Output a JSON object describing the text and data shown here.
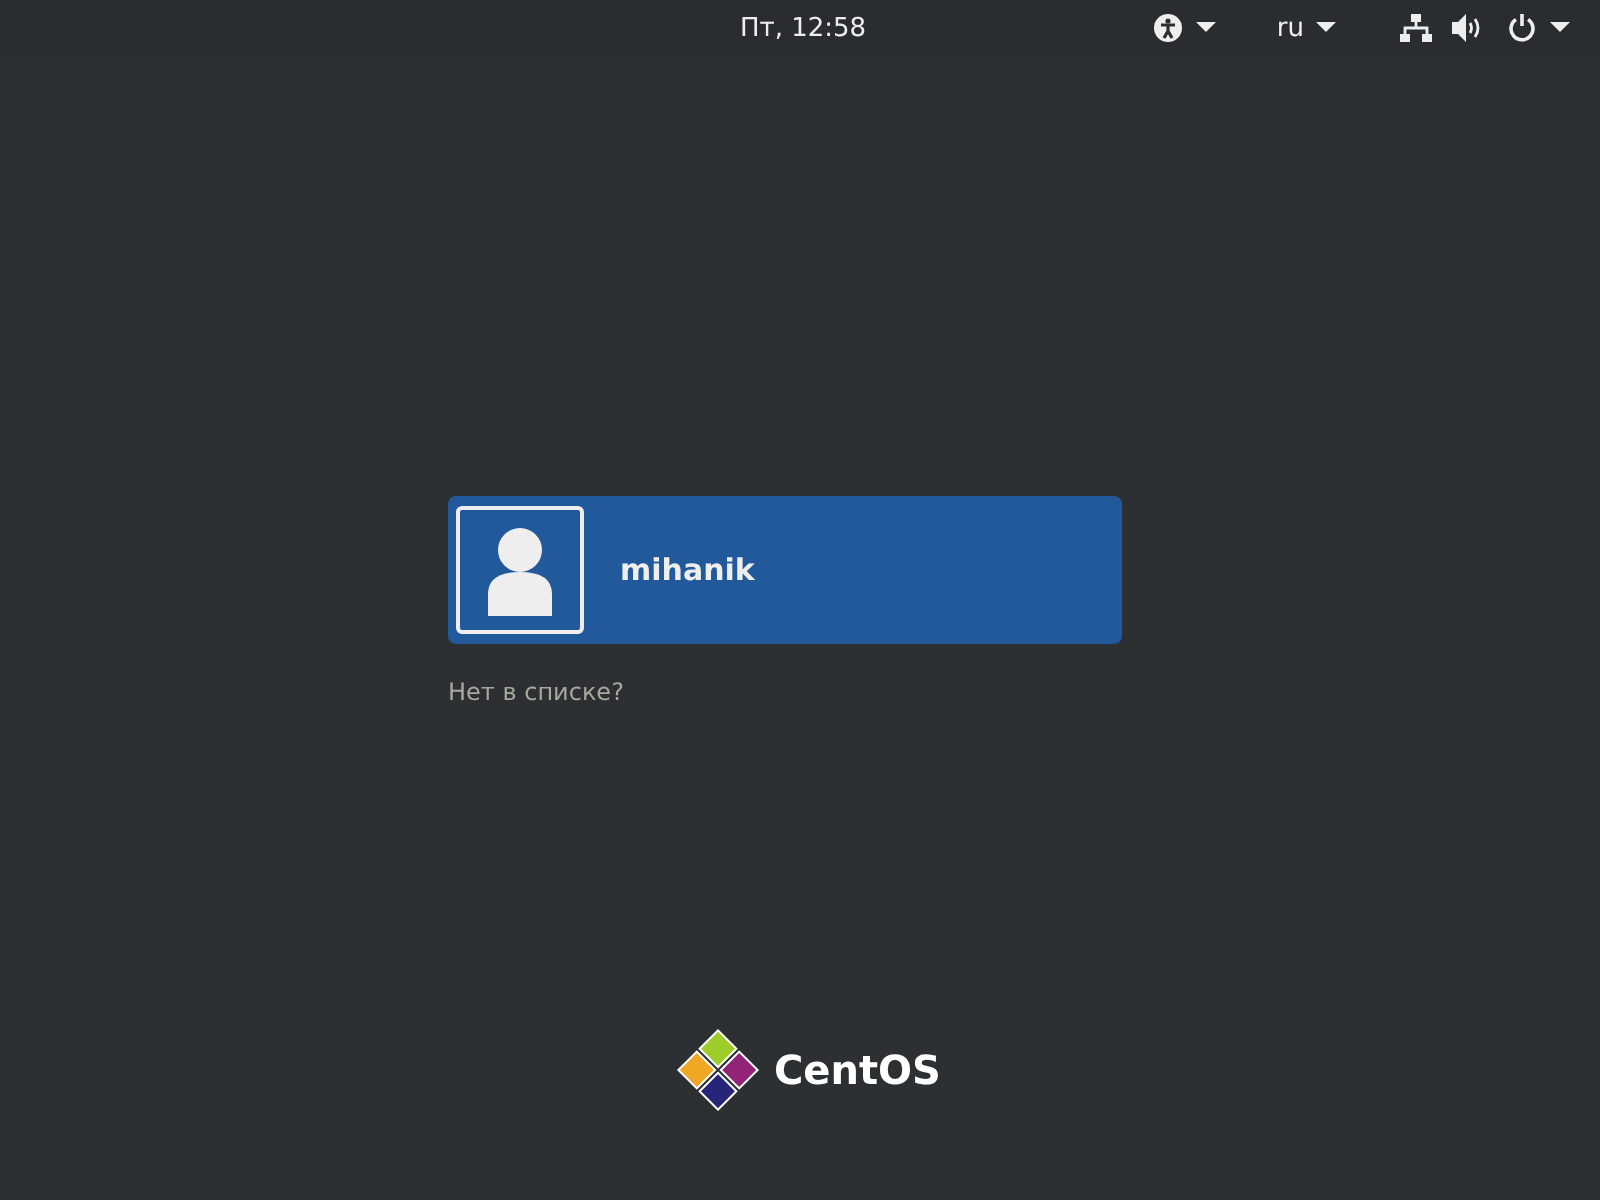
{
  "top_bar": {
    "clock": "Пт, 12:58",
    "language": "ru"
  },
  "users": [
    {
      "name": "mihanik",
      "selected": true
    }
  ],
  "not_listed_link": "Нет в списке?",
  "logo": {
    "text": "CentOS"
  }
}
